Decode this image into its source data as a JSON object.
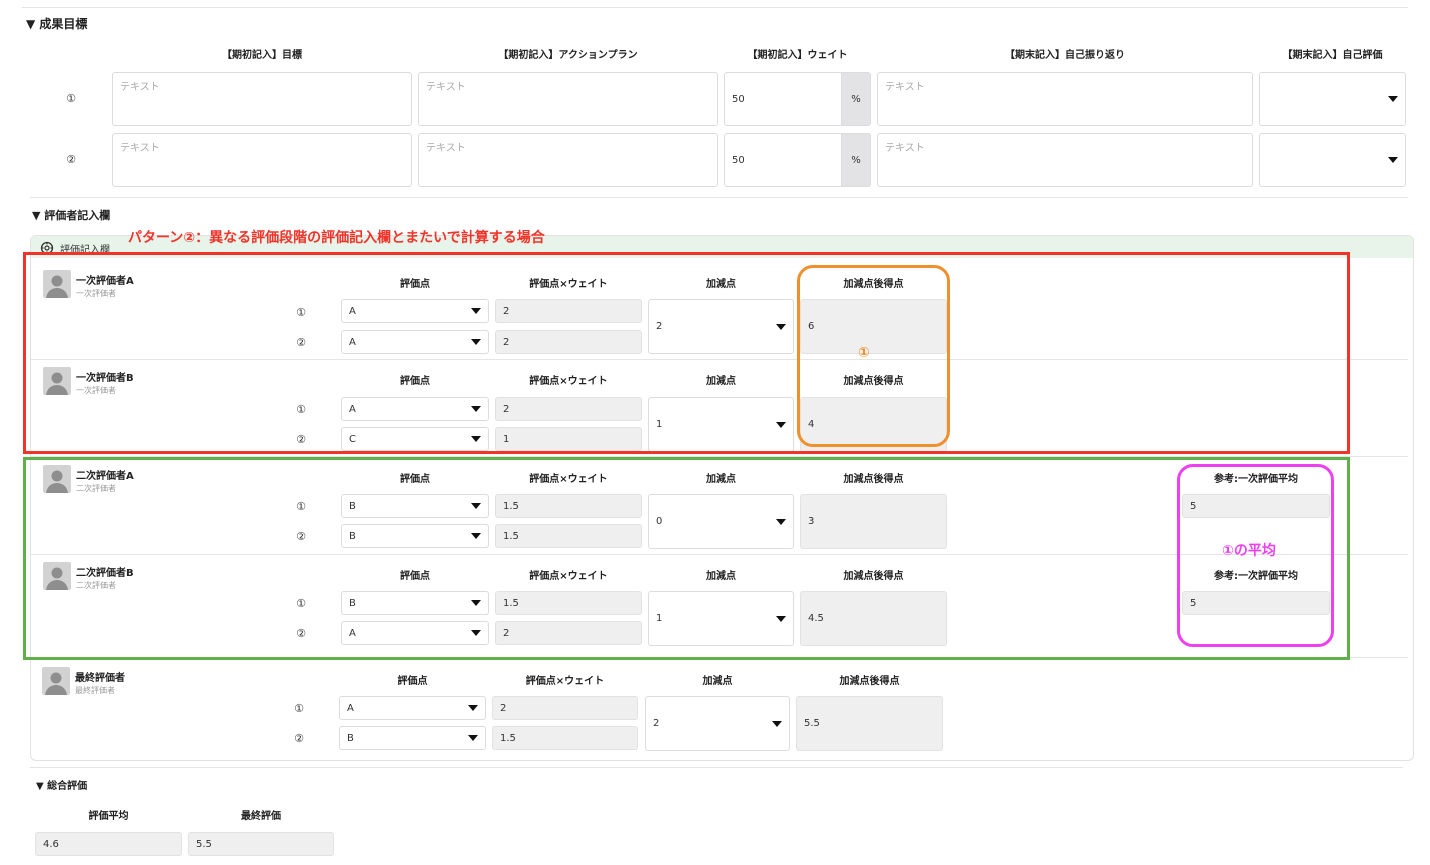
{
  "goals": {
    "section_title": "▼ 成果目標",
    "headers": {
      "goal": "【期初記入】目標",
      "action_plan": "【期初記入】アクションプラン",
      "weight": "【期初記入】ウェイト",
      "reflection": "【期末記入】自己振り返り",
      "self_eval": "【期末記入】自己評価"
    },
    "unit": "%",
    "rows": [
      {
        "num": "①",
        "goal_placeholder": "テキスト",
        "action_placeholder": "テキスト",
        "weight": "50",
        "reflection_placeholder": "テキスト",
        "self_eval": ""
      },
      {
        "num": "②",
        "goal_placeholder": "テキスト",
        "action_placeholder": "テキスト",
        "weight": "50",
        "reflection_placeholder": "テキスト",
        "self_eval": ""
      }
    ]
  },
  "evaluator_section": {
    "section_title": "▼ 評価者記入欄",
    "panel_title": "評価記入欄",
    "annotation_pattern": "パターン②：異なる評価段階の評価記入欄とまたいで計算する場合",
    "annotation_circle1": "①",
    "annotation_avg": "①の平均",
    "col_headers": {
      "score": "評価点",
      "score_weight": "評価点×ウェイト",
      "adjust": "加減点",
      "after": "加減点後得点",
      "reference": "参考:一次評価平均"
    },
    "evaluators": [
      {
        "name": "一次評価者A",
        "role": "一次評価者",
        "rows": [
          {
            "num": "①",
            "grade": "A",
            "weighted": "2"
          },
          {
            "num": "②",
            "grade": "A",
            "weighted": "2"
          }
        ],
        "adjust": "2",
        "after": "6"
      },
      {
        "name": "一次評価者B",
        "role": "一次評価者",
        "rows": [
          {
            "num": "①",
            "grade": "A",
            "weighted": "2"
          },
          {
            "num": "②",
            "grade": "C",
            "weighted": "1"
          }
        ],
        "adjust": "1",
        "after": "4"
      },
      {
        "name": "二次評価者A",
        "role": "二次評価者",
        "rows": [
          {
            "num": "①",
            "grade": "B",
            "weighted": "1.5"
          },
          {
            "num": "②",
            "grade": "B",
            "weighted": "1.5"
          }
        ],
        "adjust": "0",
        "after": "3",
        "reference": "5"
      },
      {
        "name": "二次評価者B",
        "role": "二次評価者",
        "rows": [
          {
            "num": "①",
            "grade": "B",
            "weighted": "1.5"
          },
          {
            "num": "②",
            "grade": "A",
            "weighted": "2"
          }
        ],
        "adjust": "1",
        "after": "4.5",
        "reference": "5"
      },
      {
        "name": "最終評価者",
        "role": "最終評価者",
        "rows": [
          {
            "num": "①",
            "grade": "A",
            "weighted": "2"
          },
          {
            "num": "②",
            "grade": "B",
            "weighted": "1.5"
          }
        ],
        "adjust": "2",
        "after": "5.5"
      }
    ]
  },
  "summary": {
    "section_title": "▼ 総合評価",
    "avg_label": "評価平均",
    "final_label": "最終評価",
    "avg_value": "4.6",
    "final_value": "5.5"
  },
  "colors": {
    "red": "#f0342a",
    "orange": "#f0902c",
    "green": "#5fb04a",
    "magenta": "#ee3ff0",
    "panel_header": "#e8f4ea"
  }
}
